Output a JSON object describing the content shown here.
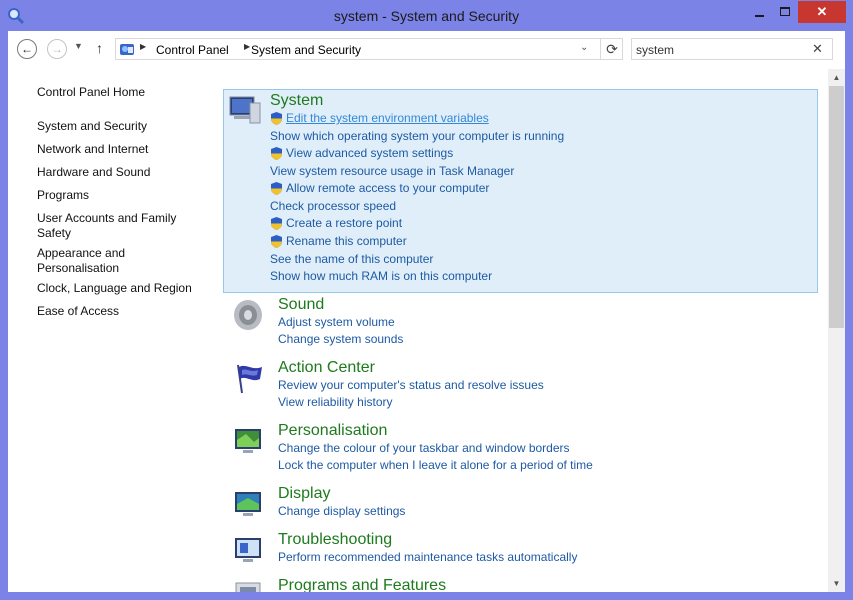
{
  "window": {
    "title": "system - System and Security",
    "minimize_label": "",
    "maximize_label": "",
    "close_label": "✕"
  },
  "nav": {
    "back_glyph": "←",
    "forward_glyph": "→",
    "recent_glyph": "▼",
    "up_glyph": "↑",
    "breadcrumbs": [
      "Control Panel",
      "System and Security"
    ],
    "refresh_glyph": "⟳",
    "dropdown_glyph": "⌄",
    "search_value": "system",
    "search_clear_glyph": "✕"
  },
  "sidebar": {
    "home": "Control Panel Home",
    "items": [
      "System and Security",
      "Network and Internet",
      "Hardware and Sound",
      "Programs",
      "User Accounts and Family Safety",
      "Appearance and Personalisation",
      "Clock, Language and Region",
      "Ease of Access"
    ]
  },
  "categories": {
    "system": {
      "title": "System",
      "icon": "computer-icon",
      "tasks": [
        {
          "label": "Edit the system environment variables",
          "shield": true
        },
        {
          "label": "Show which operating system your computer is running",
          "shield": false
        },
        {
          "label": "View advanced system settings",
          "shield": true
        },
        {
          "label": "View system resource usage in Task Manager",
          "shield": false
        },
        {
          "label": "Allow remote access to your computer",
          "shield": true
        },
        {
          "label": "Check processor speed",
          "shield": false
        },
        {
          "label": "Create a restore point",
          "shield": true
        },
        {
          "label": "Rename this computer",
          "shield": true
        },
        {
          "label": "See the name of this computer",
          "shield": false
        },
        {
          "label": "Show how much RAM is on this computer",
          "shield": false
        }
      ]
    },
    "sound": {
      "title": "Sound",
      "icon": "speaker-icon",
      "tasks": [
        "Adjust system volume",
        "Change system sounds"
      ]
    },
    "action_center": {
      "title": "Action Center",
      "icon": "flag-icon",
      "tasks": [
        "Review your computer's status and resolve issues",
        "View reliability history"
      ]
    },
    "personalisation": {
      "title": "Personalisation",
      "icon": "personalisation-icon",
      "tasks": [
        "Change the colour of your taskbar and window borders",
        "Lock the computer when I leave it alone for a period of time"
      ]
    },
    "display": {
      "title": "Display",
      "icon": "display-icon",
      "tasks": [
        "Change display settings"
      ]
    },
    "troubleshooting": {
      "title": "Troubleshooting",
      "icon": "troubleshooting-icon",
      "tasks": [
        "Perform recommended maintenance tasks automatically"
      ]
    },
    "programs_features": {
      "title": "Programs and Features",
      "icon": "programs-icon",
      "tasks": []
    }
  },
  "scrollbar": {
    "up_glyph": "▲",
    "down_glyph": "▼"
  },
  "colors": {
    "frame": "#7b84e6",
    "close_button": "#c7372f",
    "category_title": "#1e7a1e",
    "task_link": "#1e5aa3",
    "selected_bg": "#e0eefa",
    "selected_border": "#96c8ec"
  }
}
